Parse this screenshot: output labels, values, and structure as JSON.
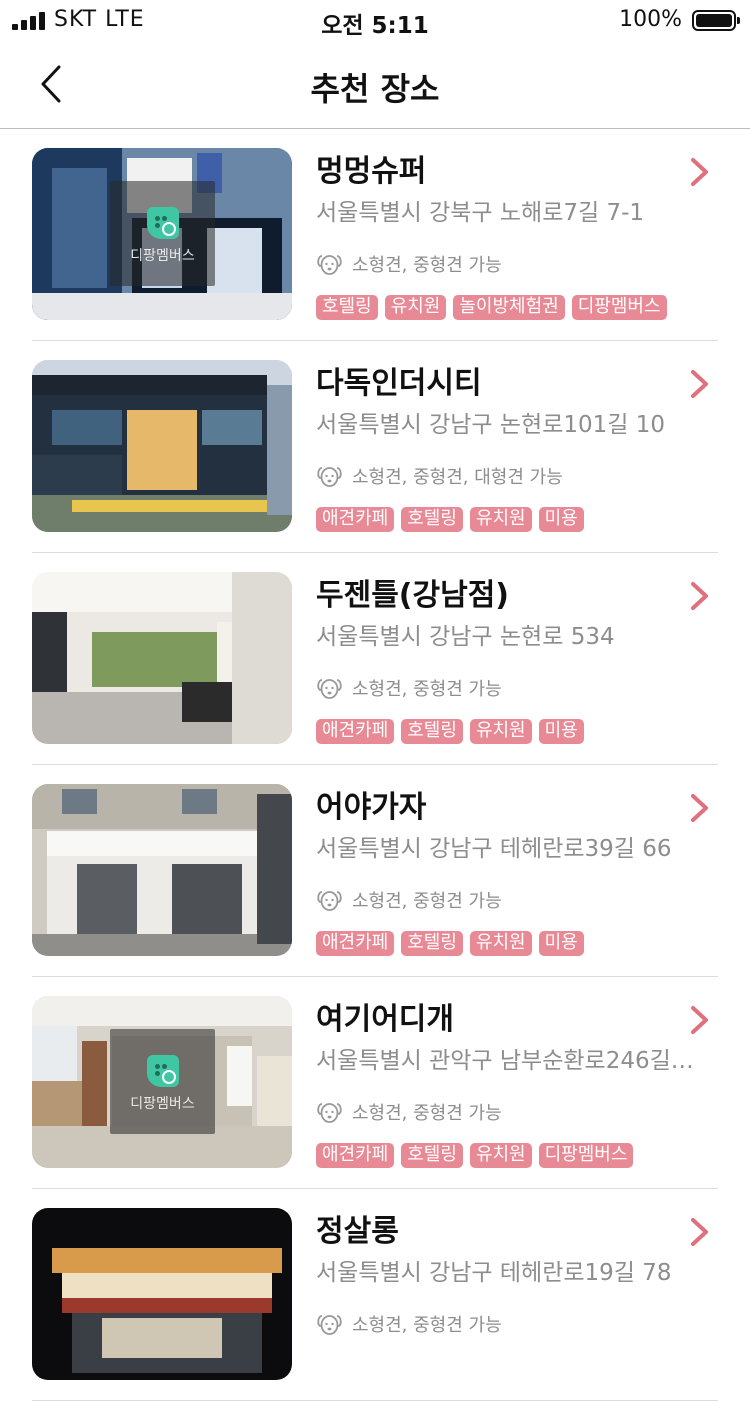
{
  "status_bar": {
    "carrier": "SKT   LTE",
    "time": "오전 5:11",
    "battery": "100%"
  },
  "nav": {
    "title": "추천 장소"
  },
  "places": [
    {
      "name": "멍멍슈퍼",
      "address": "서울특별시 강북구 노해로7길 7-1",
      "dog_size": "소형견, 중형견 가능",
      "tags": [
        "호텔링",
        "유치원",
        "놀이방체험권",
        "디팡멤버스"
      ],
      "member_badge": "디팡멤버스",
      "image_icon": "storefront-photo"
    },
    {
      "name": "다독인더시티",
      "address": "서울특별시 강남구 논현로101길 10",
      "dog_size": "소형견, 중형견, 대형견 가능",
      "tags": [
        "애견카페",
        "호텔링",
        "유치원",
        "미용"
      ],
      "member_badge": null,
      "image_icon": "building-night-photo"
    },
    {
      "name": "두젠틀(강남점)",
      "address": "서울특별시 강남구 논현로 534",
      "dog_size": "소형견, 중형견 가능",
      "tags": [
        "애견카페",
        "호텔링",
        "유치원",
        "미용"
      ],
      "member_badge": null,
      "image_icon": "interior-photo"
    },
    {
      "name": "어야가자",
      "address": "서울특별시 강남구 테헤란로39길 66",
      "dog_size": "소형견, 중형견 가능",
      "tags": [
        "애견카페",
        "호텔링",
        "유치원",
        "미용"
      ],
      "member_badge": null,
      "image_icon": "storefront-photo"
    },
    {
      "name": "여기어디개",
      "address": "서울특별시 관악구 남부순환로246길…",
      "dog_size": "소형견, 중형견 가능",
      "tags": [
        "애견카페",
        "호텔링",
        "유치원",
        "디팡멤버스"
      ],
      "member_badge": "디팡멤버스",
      "image_icon": "interior-photo"
    },
    {
      "name": "정살롱",
      "address": "서울특별시 강남구 테헤란로19길 78",
      "dog_size": "소형견, 중형견 가능",
      "tags": [],
      "member_badge": null,
      "image_icon": "night-terrace-photo"
    }
  ],
  "colors": {
    "accent": "#e88a96",
    "text_secondary": "#8d8d8d",
    "chevron": "#e0707e"
  },
  "icons": {
    "back": "chevron-left-icon",
    "row_arrow": "chevron-right-icon",
    "dog": "dog-face-icon",
    "member": "difang-logo-icon"
  }
}
